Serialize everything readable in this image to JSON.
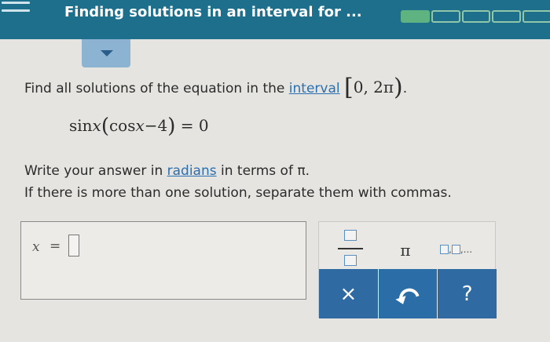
{
  "header": {
    "title": "Finding solutions in an interval for ...",
    "progress": {
      "completed": 1,
      "total": 5
    }
  },
  "question": {
    "prompt_before": "Find all solutions of the equation in the ",
    "interval_link": "interval",
    "interval_math": "0,  2π",
    "prompt_after": ".",
    "equation_left": "sin",
    "equation_x1": "x",
    "equation_mid": "cos",
    "equation_x2": "x",
    "equation_tail": "−4",
    "equation_rhs": "= 0"
  },
  "instructions": {
    "line1_before": "Write your answer in ",
    "line1_link": "radians",
    "line1_after": " in terms of π.",
    "line2": "If there is more than one solution, separate them with commas."
  },
  "answer": {
    "variable": "x",
    "equals": "=",
    "value": ""
  },
  "keypad": {
    "pi_key": "π",
    "clear_key": "×",
    "help_key": "?",
    "list_sep": ",",
    "list_dots": "..."
  },
  "colors": {
    "header_bg": "#1d6f8c",
    "progress_done": "#5fb381",
    "keypad_blue": "#2f6aa3",
    "link": "#2a6fb0"
  }
}
